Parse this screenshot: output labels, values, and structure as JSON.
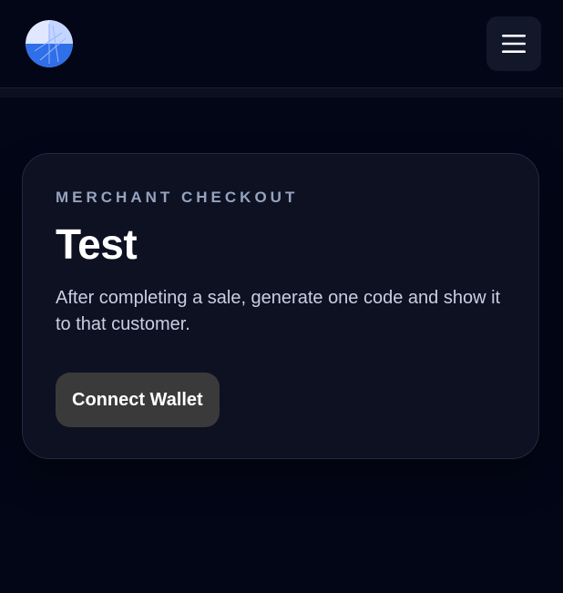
{
  "header": {
    "logo_icon": "globe-logo-icon",
    "menu_icon": "hamburger-menu-icon"
  },
  "card": {
    "eyebrow": "MERCHANT CHECKOUT",
    "title": "Test",
    "description": "After completing a sale, generate one code and show it to that customer.",
    "connect_button_label": "Connect Wallet"
  },
  "colors": {
    "background": "#030616",
    "card_background": "#0d1122",
    "eyebrow_text": "#97a3be",
    "title_text": "#ffffff",
    "description_text": "#c8cfe0",
    "button_background": "#3a3a3a",
    "logo_blue": "#2f6fe8"
  }
}
